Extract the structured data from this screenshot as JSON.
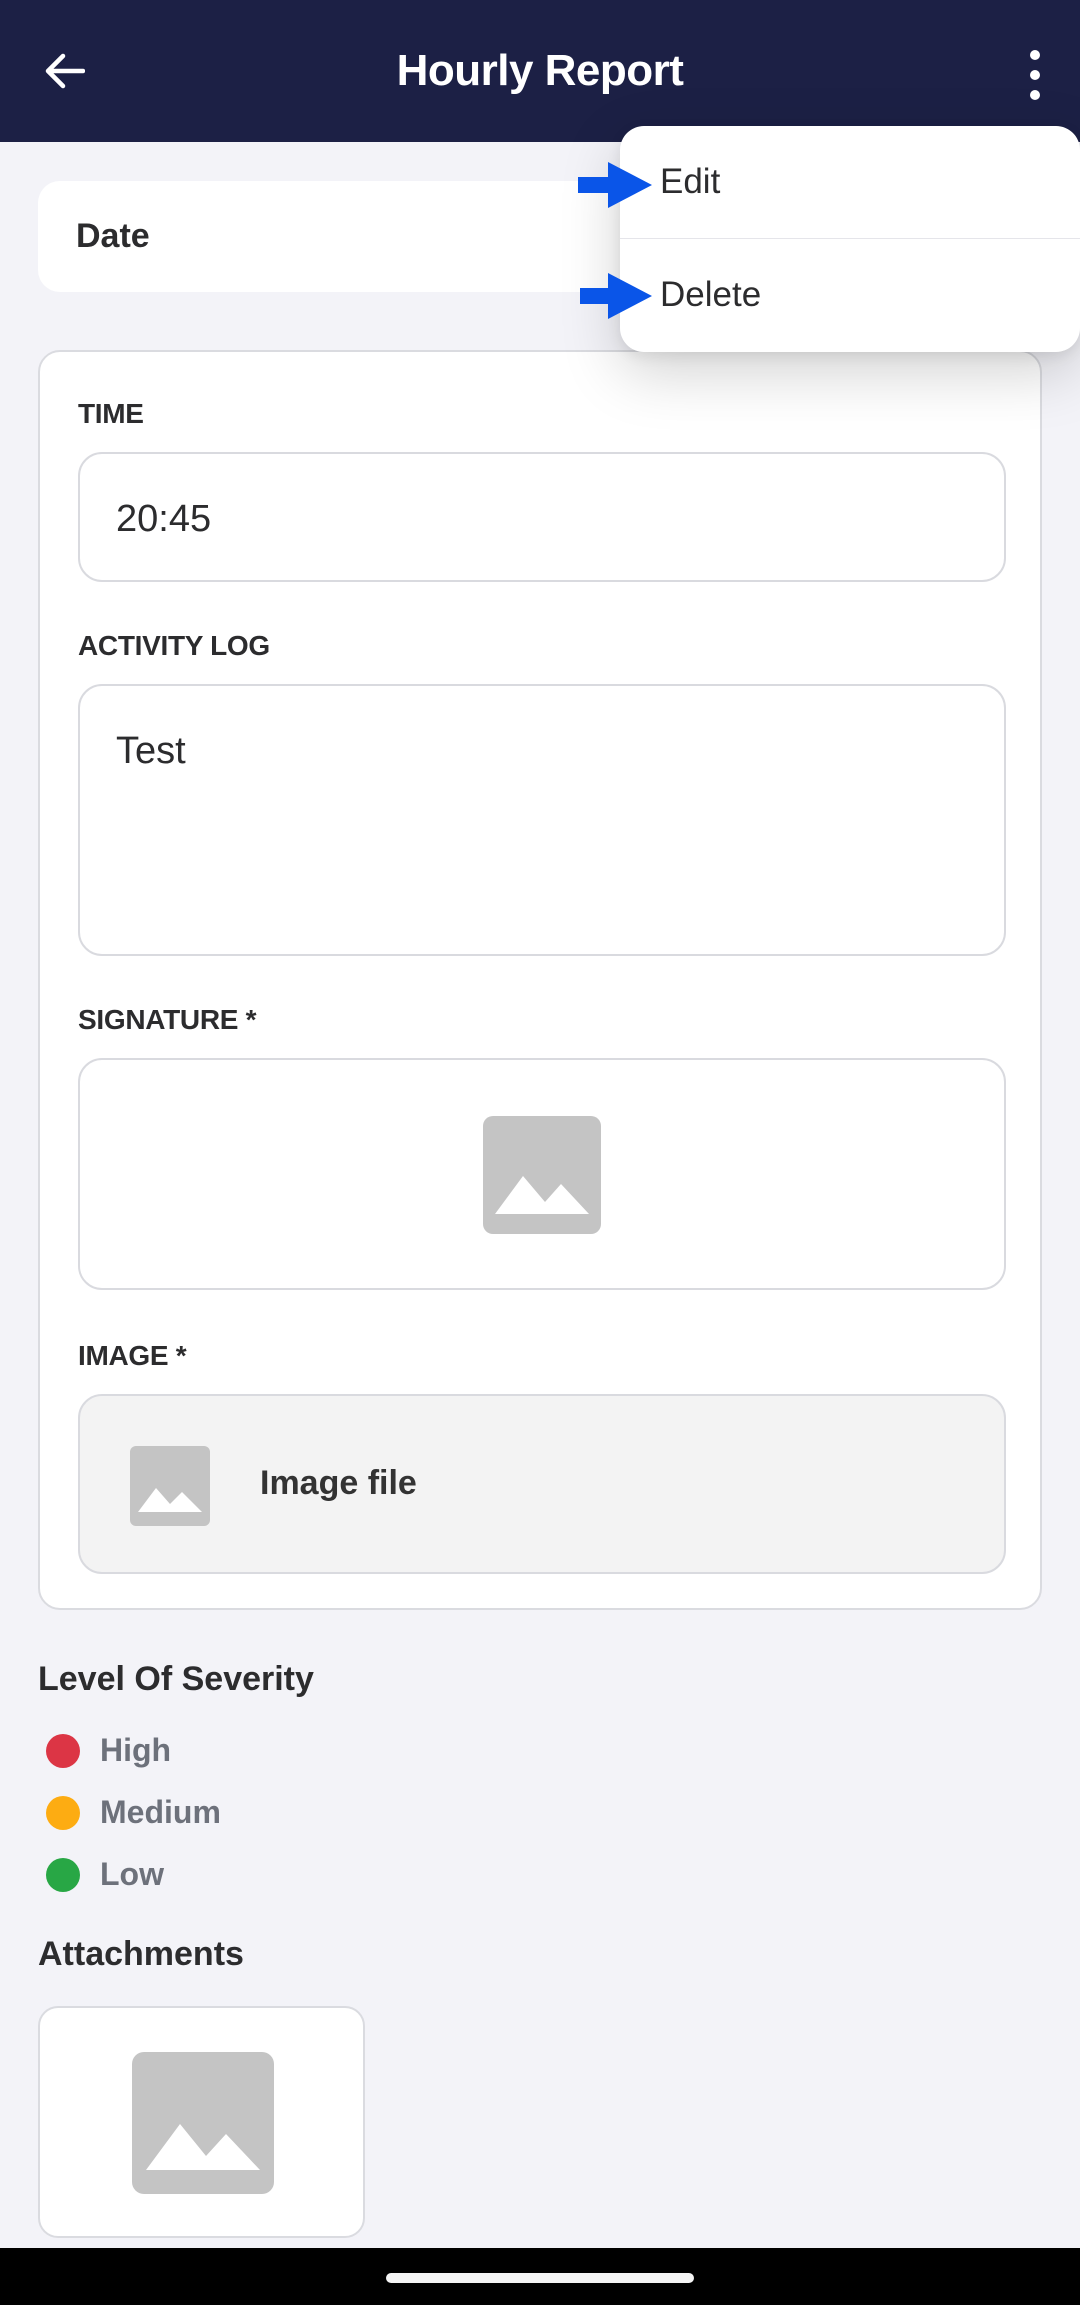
{
  "header": {
    "title": "Hourly Report"
  },
  "date": {
    "label": "Date"
  },
  "form": {
    "time": {
      "label": "TIME",
      "value": "20:45"
    },
    "activity_log": {
      "label": "ACTIVITY LOG",
      "value": "Test"
    },
    "signature": {
      "label": "SIGNATURE *"
    },
    "image": {
      "label": "IMAGE *",
      "file_text": "Image file"
    }
  },
  "severity": {
    "title": "Level Of Severity",
    "levels": [
      {
        "label": "High",
        "color": "#dc3545"
      },
      {
        "label": "Medium",
        "color": "#fdac12"
      },
      {
        "label": "Low",
        "color": "#28a745"
      }
    ]
  },
  "attachments": {
    "title": "Attachments"
  },
  "menu": {
    "items": [
      "Edit",
      "Delete"
    ]
  },
  "colors": {
    "header_bg": "#1c2045",
    "pointer": "#0a55e8"
  }
}
